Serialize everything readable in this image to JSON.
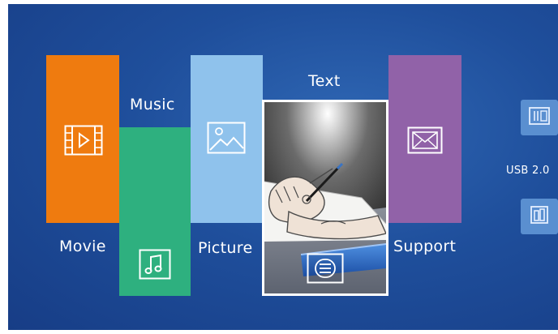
{
  "menu": {
    "movie": {
      "label": "Movie",
      "color": "#ef7b0f"
    },
    "music": {
      "label": "Music",
      "color": "#2eb07f"
    },
    "picture": {
      "label": "Picture",
      "color": "#8fc2ec"
    },
    "text": {
      "label": "Text",
      "selected": true
    },
    "support": {
      "label": "Support",
      "color": "#9162a8"
    }
  },
  "side": {
    "usb_label": "USB 2.0",
    "icons": [
      "sd-card-icon",
      "usb-drive-icon"
    ]
  },
  "colors": {
    "background": "#1f4f9c",
    "side_box": "#5a8fd0",
    "selection_border": "#ffffff"
  }
}
